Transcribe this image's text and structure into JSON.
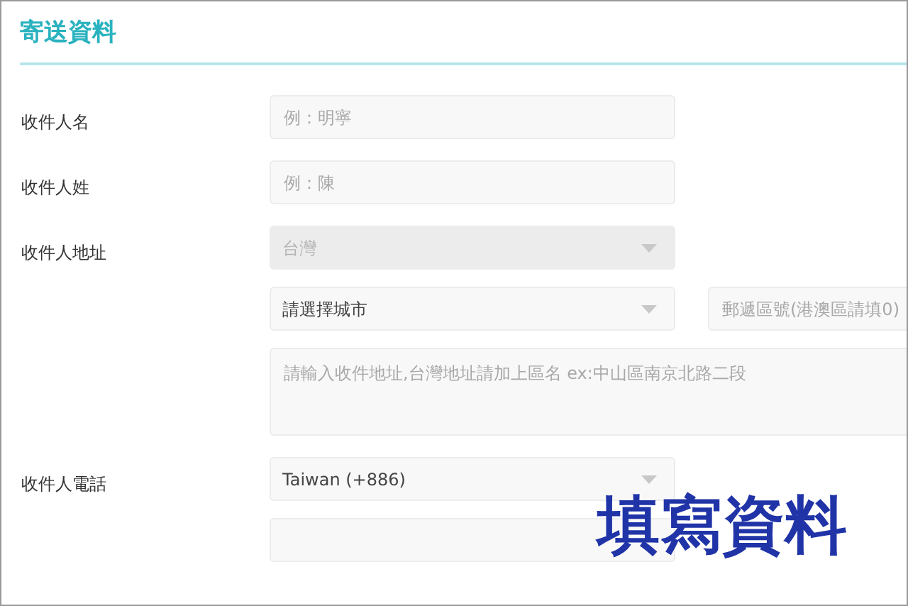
{
  "section_title": "寄送資料",
  "fields": [
    {
      "label": "收件人名",
      "controls": [
        {
          "kind": "input",
          "placeholder": "例：明寧"
        }
      ]
    },
    {
      "label": "收件人姓",
      "controls": [
        {
          "kind": "input",
          "placeholder": "例：陳"
        }
      ]
    },
    {
      "label": "收件人地址",
      "controls": [
        {
          "kind": "select",
          "value": "台灣",
          "disabled": true
        },
        {
          "kind": "select_pair",
          "value": "請選擇城市",
          "disabled": false,
          "side_placeholder": "郵遞區號(港澳區請填0)"
        },
        {
          "kind": "textarea",
          "placeholder": "請輸入收件地址,台灣地址請加上區名 ex:中山區南京北路二段"
        }
      ]
    },
    {
      "label": "收件人電話",
      "controls": [
        {
          "kind": "select",
          "value": "Taiwan (+886)",
          "disabled": false
        },
        {
          "kind": "input"
        }
      ]
    }
  ],
  "overlay_caption": "填寫資料"
}
